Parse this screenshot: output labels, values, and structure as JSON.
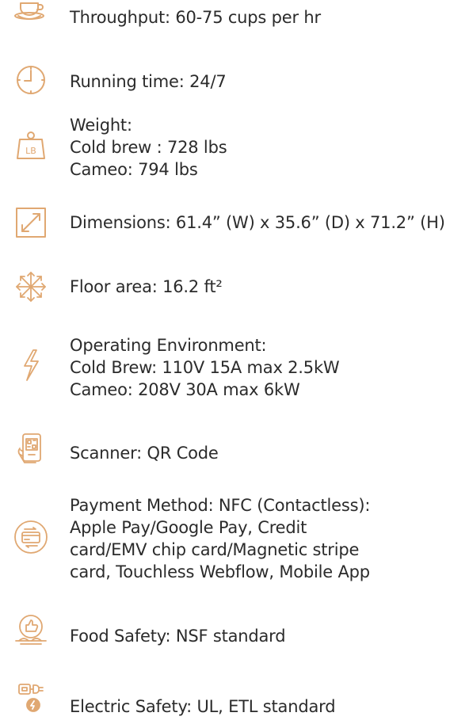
{
  "accent_color": "#e0a872",
  "specs": [
    {
      "icon": "coffee-cup-icon",
      "lines": [
        "Throughput: 60-75 cups per hr"
      ]
    },
    {
      "icon": "clock-icon",
      "lines": [
        "Running time: 24/7"
      ]
    },
    {
      "icon": "weight-icon",
      "lines": [
        "Weight:",
        "Cold brew : 728 lbs",
        "Cameo: 794 lbs"
      ]
    },
    {
      "icon": "dimensions-arrow-icon",
      "lines": [
        "Dimensions: 61.4” (W) x 35.6” (D) x 71.2” (H)"
      ]
    },
    {
      "icon": "floor-area-arrows-icon",
      "lines": [
        "Floor area: 16.2 ft²"
      ]
    },
    {
      "icon": "lightning-bolt-icon",
      "lines": [
        "Operating Environment:",
        "Cold Brew: 110V 15A max 2.5kW",
        "Cameo: 208V 30A max 6kW"
      ]
    },
    {
      "icon": "qr-scanner-phone-icon",
      "lines": [
        "Scanner: QR Code"
      ]
    },
    {
      "icon": "payment-card-icon",
      "lines": [
        "Payment Method: NFC (Contactless):",
        "Apple Pay/Google Pay, Credit",
        "card/EMV chip card/Magnetic stripe",
        "card, Touchless Webflow, Mobile App"
      ]
    },
    {
      "icon": "food-safety-icon",
      "lines": [
        "Food Safety: NSF standard"
      ]
    },
    {
      "icon": "electric-plug-icon",
      "lines": [
        "Electric Safety: UL, ETL standard"
      ]
    }
  ]
}
